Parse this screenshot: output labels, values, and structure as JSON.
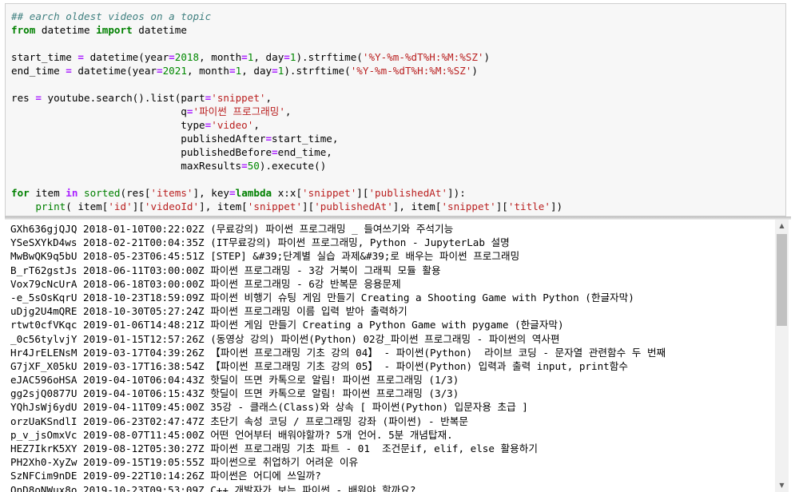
{
  "code_cell": {
    "lines": [
      "## earch oldest videos on a topic",
      "from datetime import datetime",
      "",
      "start_time = datetime(year=2018, month=1, day=1).strftime('%Y-%m-%dT%H:%M:%SZ')",
      "end_time = datetime(year=2021, month=1, day=1).strftime('%Y-%m-%dT%H:%M:%SZ')",
      "",
      "res = youtube.search().list(part='snippet',",
      "                            q='파이썬 프로그래밍',",
      "                            type='video',",
      "                            publishedAfter=start_time,",
      "                            publishedBefore=end_time,",
      "                            maxResults=50).execute()",
      "",
      "for item in sorted(res['items'], key=lambda x:x['snippet']['publishedAt']):",
      "    print( item['id']['videoId'], item['snippet']['publishedAt'], item['snippet']['title'])"
    ]
  },
  "output": {
    "lines": [
      "GXh636gjQJQ 2018-01-10T00:22:02Z (무료강의) 파이썬 프로그래밍 _ 들여쓰기와 주석기능",
      "YSeSXYkD4ws 2018-02-21T00:04:35Z (IT무료강의) 파이썬 프로그래밍, Python - JupyterLab 설명",
      "MwBwQK9q5bU 2018-05-23T06:45:51Z [STEP] &#39;단계별 실습 과제&#39;로 배우는 파이썬 프로그래밍",
      "B_rT62gstJs 2018-06-11T03:00:00Z 파이썬 프로그래밍 - 3강 거북이 그래픽 모듈 활용",
      "Vox79cNcUrA 2018-06-18T03:00:00Z 파이썬 프로그래밍 - 6강 반복문 응용문제",
      "-e_5sOsKqrU 2018-10-23T18:59:09Z 파이썬 비행기 슈팅 게임 만들기 Creating a Shooting Game with Python (한글자막)",
      "uDjg2U4mQRE 2018-10-30T05:27:24Z 파이썬 프로그래밍 이름 입력 받아 출력하기",
      "rtwt0cfVKqc 2019-01-06T14:48:21Z 파이썬 게임 만들기 Creating a Python Game with pygame (한글자막)",
      "_0c56tylvjY 2019-01-15T12:57:26Z (동영상 강의) 파이썬(Python) 02강_파이썬 프로그래밍 - 파이썬의 역사편",
      "Hr4JrELENsM 2019-03-17T04:39:26Z 【파이썬 프로그래밍 기초 강의 04】 - 파이썬(Python)  라이브 코딩 - 문자열 관련함수 두 번째",
      "G7jXF_X05kU 2019-03-17T16:38:54Z 【파이썬 프로그래밍 기초 강의 05】 - 파이썬(Python) 입력과 출력 input, print함수",
      "eJAC596oHSA 2019-04-10T06:04:43Z 핫딜이 뜨면 카톡으로 알림! 파이썬 프로그래밍 (1/3)",
      "gg2sjQ0877U 2019-04-10T06:15:43Z 핫딜이 뜨면 카톡으로 알림! 파이썬 프로그래밍 (3/3)",
      "YQhJsWj6ydU 2019-04-11T09:45:00Z 35강 - 클래스(Class)와 상속 [ 파이썬(Python) 입문자용 초급 ]",
      "orzUaKSndlI 2019-06-23T02:47:47Z 초단기 속성 코딩 / 프로그래밍 강좌 (파이썬) - 반복문",
      "p_v_jsOmxVc 2019-08-07T11:45:00Z 어떤 언어부터 배워야할까? 5개 언어. 5분 개념탑재.",
      "HEZ7IkrK5XY 2019-08-12T05:30:27Z 파이썬 프로그래밍 기초 파트 - 01  조건문if, elif, else 활용하기",
      "PH2Xh0-XyZw 2019-09-15T19:05:55Z 파이썬으로 취업하기 어려운 이유",
      "SzNFCim9nDE 2019-09-22T10:14:26Z 파이썬은 어디에 쓰일까?",
      "OnD8oNWux8o 2019-10-23T09:53:09Z C++ 개발자가 보는 파이썬 - 배워야 할까요?"
    ]
  },
  "scrollbar": {
    "up_arrow": "▲",
    "down_arrow": "▼"
  }
}
